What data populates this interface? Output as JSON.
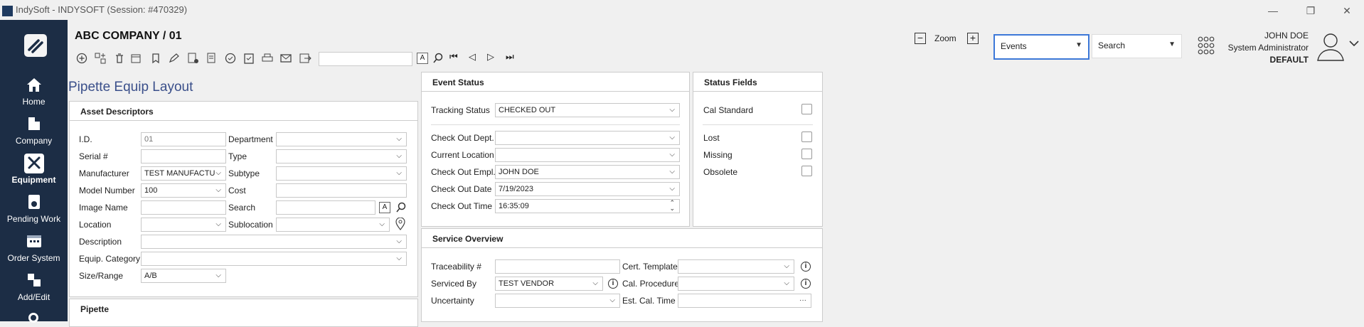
{
  "window": {
    "title": "IndySoft - INDYSOFT (Session: #470329)",
    "minimize": "—",
    "restore": "❐",
    "close": "✕"
  },
  "sidebar": {
    "items": [
      {
        "label": "Home",
        "icon": "home-icon"
      },
      {
        "label": "Company",
        "icon": "building-icon"
      },
      {
        "label": "Equipment",
        "icon": "tools-icon"
      },
      {
        "label": "Pending Work",
        "icon": "pending-work-icon"
      },
      {
        "label": "Order System",
        "icon": "calendar-icon"
      },
      {
        "label": "Add/Edit",
        "icon": "cubes-icon"
      }
    ]
  },
  "header": {
    "company": "ABC COMPANY",
    "separator": "/",
    "record": "01",
    "zoom_label": "Zoom",
    "zoom_minus": "−",
    "zoom_plus": "+",
    "events_value": "Events",
    "search_value": "Search",
    "user_name": "JOHN DOE",
    "user_role": "System Administrator",
    "user_group": "DEFAULT"
  },
  "toolbar": {
    "icons": [
      "add-icon",
      "new-layout-icon",
      "delete-icon",
      "calendar-edit-icon",
      "bookmark-icon",
      "edit-icon",
      "report-icon",
      "checkout-icon",
      "calibration-icon",
      "clipboard-icon",
      "print-icon",
      "email-icon",
      "export-icon"
    ],
    "search_value": "",
    "a_label": "A",
    "nav": [
      "⏮",
      "◁",
      "▷",
      "⏭"
    ]
  },
  "layout_title": "Pipette Equip Layout",
  "asset_descriptors": {
    "title": "Asset Descriptors",
    "fields": {
      "id_label": "I.D.",
      "id_value": "01",
      "department_label": "Department",
      "department_value": "",
      "serial_label": "Serial #",
      "serial_value": "",
      "type_label": "Type",
      "type_value": "",
      "manufacturer_label": "Manufacturer",
      "manufacturer_value": "TEST MANUFACTU",
      "subtype_label": "Subtype",
      "subtype_value": "",
      "model_label": "Model Number",
      "model_value": "100",
      "cost_label": "Cost",
      "cost_value": "",
      "image_label": "Image Name",
      "image_value": "",
      "search_label": "Search",
      "search_value": "",
      "search_a": "A",
      "location_label": "Location",
      "location_value": "",
      "sublocation_label": "Sublocation",
      "sublocation_value": "",
      "description_label": "Description",
      "description_value": "",
      "category_label": "Equip. Category",
      "category_value": "",
      "size_label": "Size/Range",
      "size_value": "A/B"
    }
  },
  "pipette_panel": {
    "title": "Pipette"
  },
  "event_status": {
    "title": "Event Status",
    "tracking_label": "Tracking Status",
    "tracking_value": "CHECKED OUT",
    "dept_label": "Check Out Dept.",
    "dept_value": "",
    "location_label": "Current Location",
    "location_value": "",
    "empl_label": "Check Out Empl.",
    "empl_value": "JOHN DOE",
    "date_label": "Check Out Date",
    "date_value": "7/19/2023",
    "time_label": "Check Out Time",
    "time_value": "16:35:09"
  },
  "status_fields": {
    "title": "Status Fields",
    "cal_standard": "Cal Standard",
    "lost": "Lost",
    "missing": "Missing",
    "obsolete": "Obsolete"
  },
  "service_overview": {
    "title": "Service Overview",
    "traceability_label": "Traceability #",
    "traceability_value": "",
    "cert_label": "Cert. Template",
    "cert_value": "",
    "serviced_label": "Serviced By",
    "serviced_value": "TEST VENDOR",
    "procedure_label": "Cal. Procedure",
    "procedure_value": "",
    "uncertainty_label": "Uncertainty",
    "uncertainty_value": "",
    "est_label": "Est. Cal. Time",
    "est_value": "",
    "est_button": "···"
  },
  "colors": {
    "sidebar": "#1c2d45",
    "accent": "#3c78d8",
    "layout_title": "#3a4f8a"
  }
}
